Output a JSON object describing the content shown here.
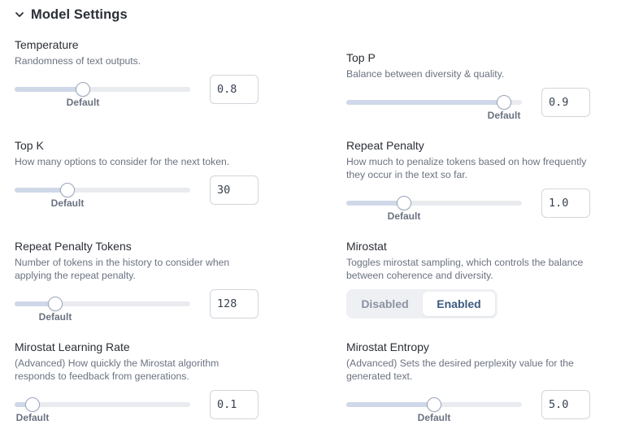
{
  "section": {
    "title": "Model Settings",
    "icon": "chevron-down-icon"
  },
  "settings": {
    "temperature": {
      "label": "Temperature",
      "desc": "Randomness of text outputs.",
      "value": "0.8",
      "default_label": "Default",
      "position": 0.39
    },
    "top_p": {
      "label": "Top P",
      "desc": "Balance between diversity & quality.",
      "value": "0.9",
      "default_label": "Default",
      "position": 0.9
    },
    "top_k": {
      "label": "Top K",
      "desc": "How many options to consider for the next token.",
      "value": "30",
      "default_label": "Default",
      "position": 0.3
    },
    "repeat_penalty": {
      "label": "Repeat Penalty",
      "desc": "How much to penalize tokens based on how frequently they occur in the text so far.",
      "value": "1.0",
      "default_label": "Default",
      "position": 0.33
    },
    "repeat_penalty_tokens": {
      "label": "Repeat Penalty Tokens",
      "desc": "Number of tokens in the history to consider when applying the repeat penalty.",
      "value": "128",
      "default_label": "Default",
      "position": 0.23
    },
    "mirostat": {
      "label": "Mirostat",
      "desc": "Toggles mirostat sampling, which controls the balance between coherence and diversity.",
      "options": [
        "Disabled",
        "Enabled"
      ],
      "selected": "Enabled"
    },
    "mirostat_learning_rate": {
      "label": "Mirostat Learning Rate",
      "desc": "(Advanced) How quickly the Mirostat algorithm responds to feedback from generations.",
      "value": "0.1",
      "default_label": "Default",
      "position": 0.1
    },
    "mirostat_entropy": {
      "label": "Mirostat Entropy",
      "desc": "(Advanced) Sets the desired perplexity value for the generated text.",
      "value": "5.0",
      "default_label": "Default",
      "position": 0.5
    }
  }
}
